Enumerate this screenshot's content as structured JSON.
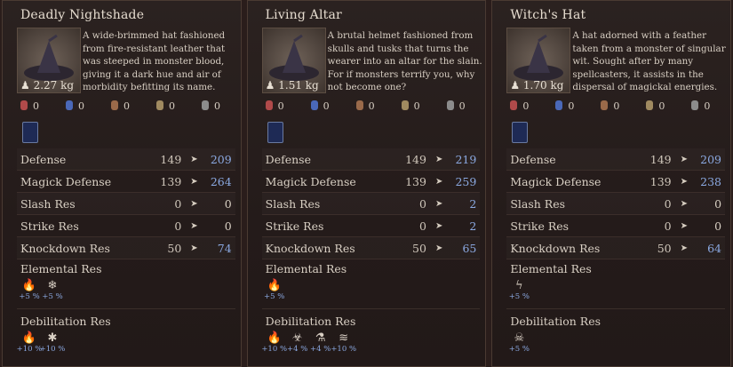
{
  "panels": [
    {
      "title": "Deadly Nightshade",
      "weight": "2.27 kg",
      "description": "A wide-brimmed hat fashioned from fire-resistant leather that was steeped in monster blood, giving it a dark hue and air of morbidity befitting its name.",
      "resistances": [
        "0",
        "0",
        "0",
        "0",
        "0"
      ],
      "stats": [
        {
          "label": "Defense",
          "old": "149",
          "new": "209"
        },
        {
          "label": "Magick Defense",
          "old": "139",
          "new": "264"
        },
        {
          "label": "Slash Res",
          "old": "0",
          "new": "0"
        },
        {
          "label": "Strike Res",
          "old": "0",
          "new": "0"
        },
        {
          "label": "Knockdown Res",
          "old": "50",
          "new": "74"
        }
      ],
      "elemental_label": "Elemental Res",
      "elemental": [
        {
          "icon": "fire-icon",
          "glyph": "🔥",
          "pct": "+5 %"
        },
        {
          "icon": "ice-icon",
          "glyph": "❄",
          "pct": "+5 %"
        }
      ],
      "debilitation_label": "Debilitation Res",
      "debilitation": [
        {
          "icon": "burn-icon",
          "glyph": "🔥",
          "pct": "+10 %"
        },
        {
          "icon": "frozen-icon",
          "glyph": "✱",
          "pct": "+10 %"
        }
      ]
    },
    {
      "title": "Living Altar",
      "weight": "1.51 kg",
      "description": "A brutal helmet fashioned from skulls and tusks that turns the wearer into an altar for the slain. For if monsters terrify you, why not become one?",
      "resistances": [
        "0",
        "0",
        "0",
        "0",
        "0"
      ],
      "stats": [
        {
          "label": "Defense",
          "old": "149",
          "new": "219"
        },
        {
          "label": "Magick Defense",
          "old": "139",
          "new": "259"
        },
        {
          "label": "Slash Res",
          "old": "0",
          "new": "2"
        },
        {
          "label": "Strike Res",
          "old": "0",
          "new": "2"
        },
        {
          "label": "Knockdown Res",
          "old": "50",
          "new": "65"
        }
      ],
      "elemental_label": "Elemental Res",
      "elemental": [
        {
          "icon": "fire-icon",
          "glyph": "🔥",
          "pct": "+5 %"
        }
      ],
      "debilitation_label": "Debilitation Res",
      "debilitation": [
        {
          "icon": "burn-icon",
          "glyph": "🔥",
          "pct": "+10 %"
        },
        {
          "icon": "poison-icon",
          "glyph": "☣",
          "pct": "+4 %"
        },
        {
          "icon": "potion-icon",
          "glyph": "⚗",
          "pct": "+4 %"
        },
        {
          "icon": "wave-icon",
          "glyph": "≋",
          "pct": "+10 %"
        }
      ]
    },
    {
      "title": "Witch's Hat",
      "weight": "1.70 kg",
      "description": "A hat adorned with a feather taken from a monster of singular wit. Sought after by many spellcasters, it assists in the dispersal of magickal energies.",
      "resistances": [
        "0",
        "0",
        "0",
        "0",
        "0"
      ],
      "stats": [
        {
          "label": "Defense",
          "old": "149",
          "new": "209"
        },
        {
          "label": "Magick Defense",
          "old": "139",
          "new": "238"
        },
        {
          "label": "Slash Res",
          "old": "0",
          "new": "0"
        },
        {
          "label": "Strike Res",
          "old": "0",
          "new": "0"
        },
        {
          "label": "Knockdown Res",
          "old": "50",
          "new": "64"
        }
      ],
      "elemental_label": "Elemental Res",
      "elemental": [
        {
          "icon": "lightning-icon",
          "glyph": "ϟ",
          "pct": "+5 %"
        }
      ],
      "debilitation_label": "Debilitation Res",
      "debilitation": [
        {
          "icon": "skull-icon",
          "glyph": "☠",
          "pct": "+5 %"
        }
      ]
    }
  ],
  "colors": {
    "increase": "#8aa8e0",
    "base": "#d9d0c4",
    "panel": "#241b1a"
  }
}
